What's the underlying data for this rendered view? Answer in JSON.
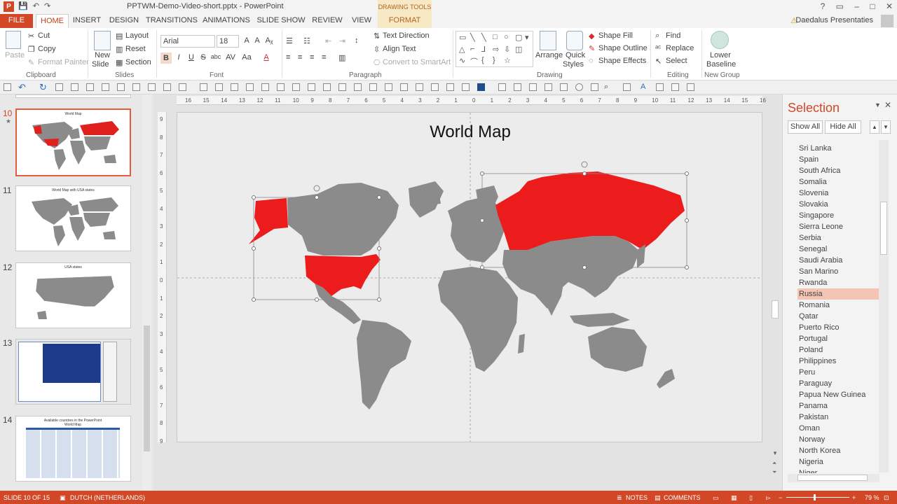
{
  "window": {
    "title": "PPTWM-Demo-Video-short.pptx - PowerPoint",
    "app_icon": "P",
    "contextual_group": "DRAWING TOOLS",
    "controls": [
      "?",
      "▭",
      "–",
      "□",
      "✕"
    ]
  },
  "tabs": [
    "FILE",
    "HOME",
    "INSERT",
    "DESIGN",
    "TRANSITIONS",
    "ANIMATIONS",
    "SLIDE SHOW",
    "REVIEW",
    "VIEW",
    "FORMAT"
  ],
  "user": {
    "name": "Daedalus Presentaties"
  },
  "ribbon": {
    "clipboard": {
      "paste": "Paste",
      "cut": "Cut",
      "copy": "Copy",
      "format_painter": "Format Painter",
      "label": "Clipboard"
    },
    "slides": {
      "new_slide_1": "New",
      "new_slide_2": "Slide",
      "layout": "Layout",
      "reset": "Reset",
      "section": "Section",
      "label": "Slides"
    },
    "font": {
      "name": "Arial",
      "size": "18",
      "grow": "A",
      "shrink": "A",
      "clear": "Aᵪ",
      "bold": "B",
      "italic": "I",
      "underline": "U",
      "strike": "S",
      "shadow": "abc",
      "spacing": "AV",
      "case": "Aa",
      "color": "A",
      "label": "Font"
    },
    "paragraph": {
      "text_direction": "Text Direction",
      "align_text": "Align Text",
      "convert_smartart": "Convert to SmartArt",
      "label": "Paragraph"
    },
    "drawing": {
      "arrange": "Arrange",
      "quick_styles_1": "Quick",
      "quick_styles_2": "Styles",
      "shape_fill": "Shape Fill",
      "shape_outline": "Shape Outline",
      "shape_effects": "Shape Effects",
      "label": "Drawing"
    },
    "editing": {
      "find": "Find",
      "replace": "Replace",
      "select": "Select",
      "label": "Editing"
    },
    "new_group": {
      "lower_1": "Lower",
      "lower_2": "Baseline",
      "label": "New Group"
    }
  },
  "ruler": {
    "h_ticks": [
      "16",
      "15",
      "14",
      "13",
      "12",
      "11",
      "10",
      "9",
      "8",
      "7",
      "6",
      "5",
      "4",
      "3",
      "2",
      "1",
      "0",
      "1",
      "2",
      "3",
      "4",
      "5",
      "6",
      "7",
      "8",
      "9",
      "10",
      "11",
      "12",
      "13",
      "14",
      "15",
      "16"
    ],
    "v_ticks": [
      "9",
      "8",
      "7",
      "6",
      "5",
      "4",
      "3",
      "2",
      "1",
      "0",
      "1",
      "2",
      "3",
      "4",
      "5",
      "6",
      "7",
      "8",
      "9"
    ]
  },
  "slides": [
    {
      "num": "10",
      "title": "World Map",
      "selected": true,
      "starred": true
    },
    {
      "num": "11",
      "title": "World Map with USA states"
    },
    {
      "num": "12",
      "title": "USA states"
    },
    {
      "num": "13",
      "title": ""
    },
    {
      "num": "14",
      "title": "Available countries in the PowerPoint World Map"
    }
  ],
  "slide": {
    "title": "World Map"
  },
  "selection_pane": {
    "title": "Selection",
    "show_all": "Show All",
    "hide_all": "Hide All",
    "items": [
      "Sri Lanka",
      "Spain",
      "South Africa",
      "Somalia",
      "Slovenia",
      "Slovakia",
      "Singapore",
      "Sierra Leone",
      "Serbia",
      "Senegal",
      "Saudi Arabia",
      "San Marino",
      "Rwanda",
      "Russia",
      "Romania",
      "Qatar",
      "Puerto Rico",
      "Portugal",
      "Poland",
      "Philippines",
      "Peru",
      "Paraguay",
      "Papua New Guinea",
      "Panama",
      "Pakistan",
      "Oman",
      "Norway",
      "North Korea",
      "Nigeria",
      "Niger"
    ],
    "selected": "Russia"
  },
  "status": {
    "slide_info": "SLIDE 10 OF 15",
    "language": "DUTCH (NETHERLANDS)",
    "notes": "NOTES",
    "comments": "COMMENTS",
    "zoom": "79 %"
  },
  "colors": {
    "accent": "#d24726",
    "highlight": "#ed1c1c",
    "land": "#8b8b8b",
    "selected_item": "#f4c5b4"
  }
}
